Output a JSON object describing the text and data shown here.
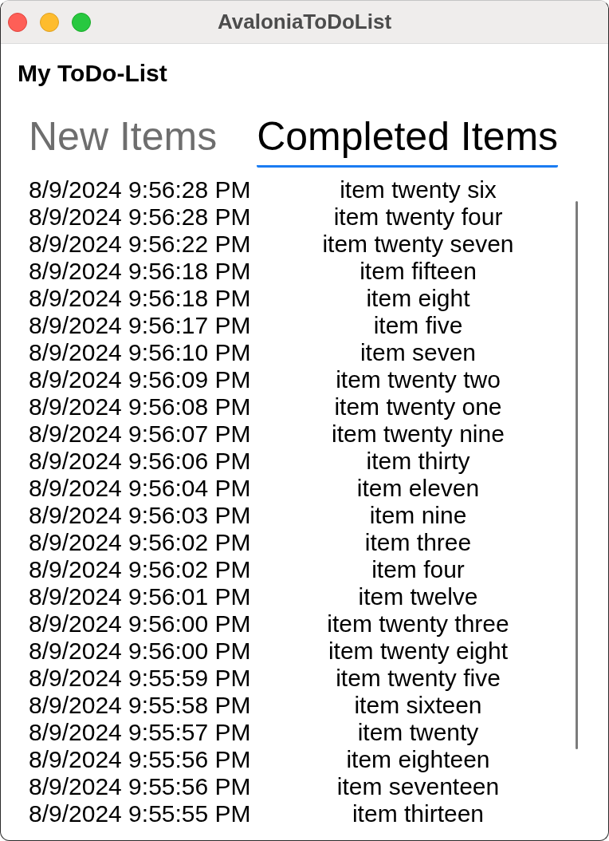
{
  "window": {
    "title": "AvaloniaToDoList"
  },
  "heading": "My ToDo-List",
  "tabs": [
    {
      "label": "New Items",
      "selected": false
    },
    {
      "label": "Completed Items",
      "selected": true
    }
  ],
  "list": {
    "rows": [
      {
        "date": "8/9/2024 9:56:28 PM",
        "item": "item twenty six"
      },
      {
        "date": "8/9/2024 9:56:28 PM",
        "item": "item twenty four"
      },
      {
        "date": "8/9/2024 9:56:22 PM",
        "item": "item twenty seven"
      },
      {
        "date": "8/9/2024 9:56:18 PM",
        "item": "item fifteen"
      },
      {
        "date": "8/9/2024 9:56:18 PM",
        "item": "item eight"
      },
      {
        "date": "8/9/2024 9:56:17 PM",
        "item": "item five"
      },
      {
        "date": "8/9/2024 9:56:10 PM",
        "item": "item seven"
      },
      {
        "date": "8/9/2024 9:56:09 PM",
        "item": "item twenty two"
      },
      {
        "date": "8/9/2024 9:56:08 PM",
        "item": "item twenty one"
      },
      {
        "date": "8/9/2024 9:56:07 PM",
        "item": "item twenty nine"
      },
      {
        "date": "8/9/2024 9:56:06 PM",
        "item": "item thirty"
      },
      {
        "date": "8/9/2024 9:56:04 PM",
        "item": "item eleven"
      },
      {
        "date": "8/9/2024 9:56:03 PM",
        "item": "item nine"
      },
      {
        "date": "8/9/2024 9:56:02 PM",
        "item": "item three"
      },
      {
        "date": "8/9/2024 9:56:02 PM",
        "item": "item four"
      },
      {
        "date": "8/9/2024 9:56:01 PM",
        "item": "item twelve"
      },
      {
        "date": "8/9/2024 9:56:00 PM",
        "item": "item twenty three"
      },
      {
        "date": "8/9/2024 9:56:00 PM",
        "item": "item twenty eight"
      },
      {
        "date": "8/9/2024 9:55:59 PM",
        "item": "item twenty five"
      },
      {
        "date": "8/9/2024 9:55:58 PM",
        "item": "item sixteen"
      },
      {
        "date": "8/9/2024 9:55:57 PM",
        "item": "item twenty"
      },
      {
        "date": "8/9/2024 9:55:56 PM",
        "item": "item eighteen"
      },
      {
        "date": "8/9/2024 9:55:56 PM",
        "item": "item seventeen"
      },
      {
        "date": "8/9/2024 9:55:55 PM",
        "item": "item thirteen"
      }
    ]
  }
}
